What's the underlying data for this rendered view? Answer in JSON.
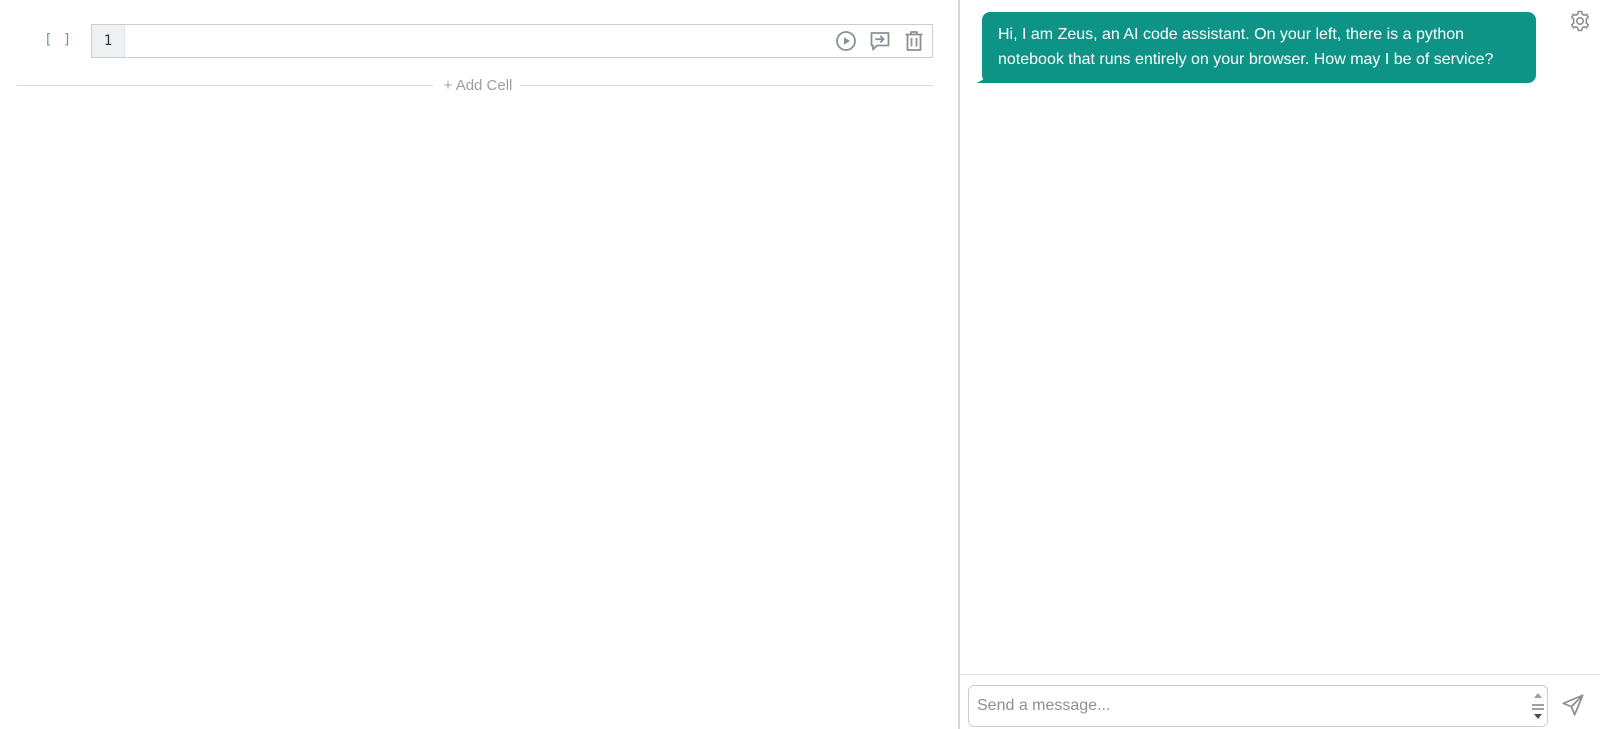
{
  "notebook": {
    "cells": [
      {
        "exec_count": "[ ]",
        "line_number": "1",
        "code": "",
        "tools": {
          "run_icon": "play-circle-icon",
          "ask_icon": "message-arrow-icon",
          "delete_icon": "trash-icon"
        }
      }
    ],
    "add_cell_label": "+ Add Cell"
  },
  "chat": {
    "settings_icon": "gear-icon",
    "messages": [
      {
        "role": "assistant",
        "text": "Hi, I am Zeus, an AI code assistant. On your left, there is a python notebook that runs entirely on your browser. How may I be of service?"
      }
    ],
    "input": {
      "value": "",
      "placeholder": "Send a message..."
    },
    "send_icon": "send-icon"
  },
  "colors": {
    "accent": "#0e9486",
    "exec_count": "#6aa36f",
    "icon_gray": "#8a9096"
  }
}
